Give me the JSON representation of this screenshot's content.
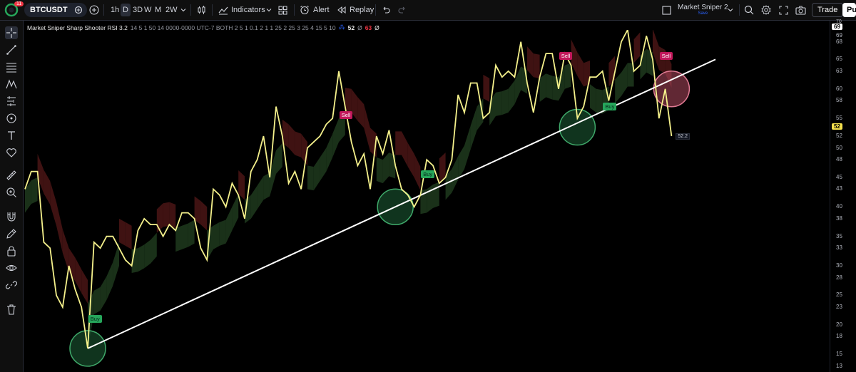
{
  "toolbar": {
    "notification_count": "11",
    "symbol": "BTCUSDT",
    "timeframes": [
      {
        "label": "1h",
        "active": false
      },
      {
        "label": "D",
        "active": true
      },
      {
        "label": "3D",
        "active": false
      },
      {
        "label": "W",
        "active": false
      },
      {
        "label": "M",
        "active": false
      },
      {
        "label": "2W",
        "active": false
      }
    ],
    "indicators_label": "Indicators",
    "alert_label": "Alert",
    "replay_label": "Replay",
    "layout_name": "Market Sniper 2",
    "layout_sub": "Save",
    "trade_label": "Trade",
    "publish_label": "Pu"
  },
  "indicator": {
    "name": "Market Sniper Sharp Shooter RSI 3.2",
    "params": "14 5 1 50 14 0000-0000 UTC-7 BOTH 2 5 1 0.1 2 1 1 25 2 25 3 25 4 15 5 10",
    "value1": "52",
    "value1_symbol": "Ø",
    "value2": "63",
    "value2_symbol": "Ø"
  },
  "colors": {
    "rsi_line": "#f4f08b",
    "trend_line": "#ffffff",
    "bull_cloud": "#1f3a1d",
    "bear_cloud": "#4a1515",
    "circle_green": "#1e5e36",
    "circle_red": "#b0485e",
    "sell_label": "#c2185b",
    "buy_label": "#26a65b",
    "current_value_bg": "#f4e04d"
  },
  "chart_data": {
    "type": "line",
    "y_axis": {
      "ticks": [
        "69",
        "68",
        "65",
        "63",
        "60",
        "58",
        "55",
        "52",
        "50",
        "48",
        "45",
        "43",
        "40",
        "38",
        "35",
        "33",
        "30",
        "28",
        "25",
        "23",
        "20",
        "18",
        "15",
        "13"
      ],
      "top_label": "70",
      "top_box_value": "69",
      "current_value": "52",
      "ylim": [
        12,
        70
      ]
    },
    "series": [
      {
        "values": [
          43,
          46,
          46,
          34,
          33,
          25,
          23,
          30,
          26,
          23,
          16,
          34,
          33,
          35,
          35,
          33,
          31,
          30,
          36,
          38,
          37,
          37,
          35,
          37,
          36,
          39,
          39,
          38,
          33,
          31,
          43,
          42,
          40,
          44,
          42,
          38,
          46,
          48,
          52,
          45,
          57,
          52,
          44,
          46,
          43,
          50,
          51,
          52,
          54,
          55,
          63,
          57,
          51,
          47,
          49,
          43,
          52,
          49,
          53,
          47,
          43,
          42,
          40,
          42,
          48,
          47,
          44,
          45,
          48,
          59,
          56,
          61,
          61,
          55,
          56,
          64,
          62,
          63,
          62,
          68,
          61,
          56,
          62,
          66,
          66,
          60,
          66,
          64,
          55,
          57,
          62,
          62,
          63,
          58,
          63,
          68,
          70,
          63,
          64,
          69,
          65,
          55,
          60,
          52
        ],
        "value_label": "52.2"
      }
    ],
    "signals": [
      {
        "type": "Buy",
        "text": "Buy",
        "index": 11,
        "value": 21
      },
      {
        "type": "Sell",
        "text": "Sell",
        "index": 51,
        "value": 55.5
      },
      {
        "type": "Buy",
        "text": "Buy",
        "index": 64,
        "value": 45.5
      },
      {
        "type": "Sell",
        "text": "Sell",
        "index": 86,
        "value": 65.5
      },
      {
        "type": "Buy",
        "text": "Buy",
        "index": 93,
        "value": 57
      },
      {
        "type": "Sell",
        "text": "Sell",
        "index": 102,
        "value": 65.5
      }
    ],
    "trendline": {
      "start": {
        "index": 10,
        "value": 16
      },
      "end": {
        "index": 110,
        "value": 65
      }
    },
    "pivot_circles": [
      {
        "color": "green",
        "index": 10,
        "value": 16
      },
      {
        "color": "green",
        "index": 59,
        "value": 40
      },
      {
        "color": "green",
        "index": 88,
        "value": 53.5
      },
      {
        "color": "red",
        "index": 103,
        "value": 60
      }
    ]
  }
}
